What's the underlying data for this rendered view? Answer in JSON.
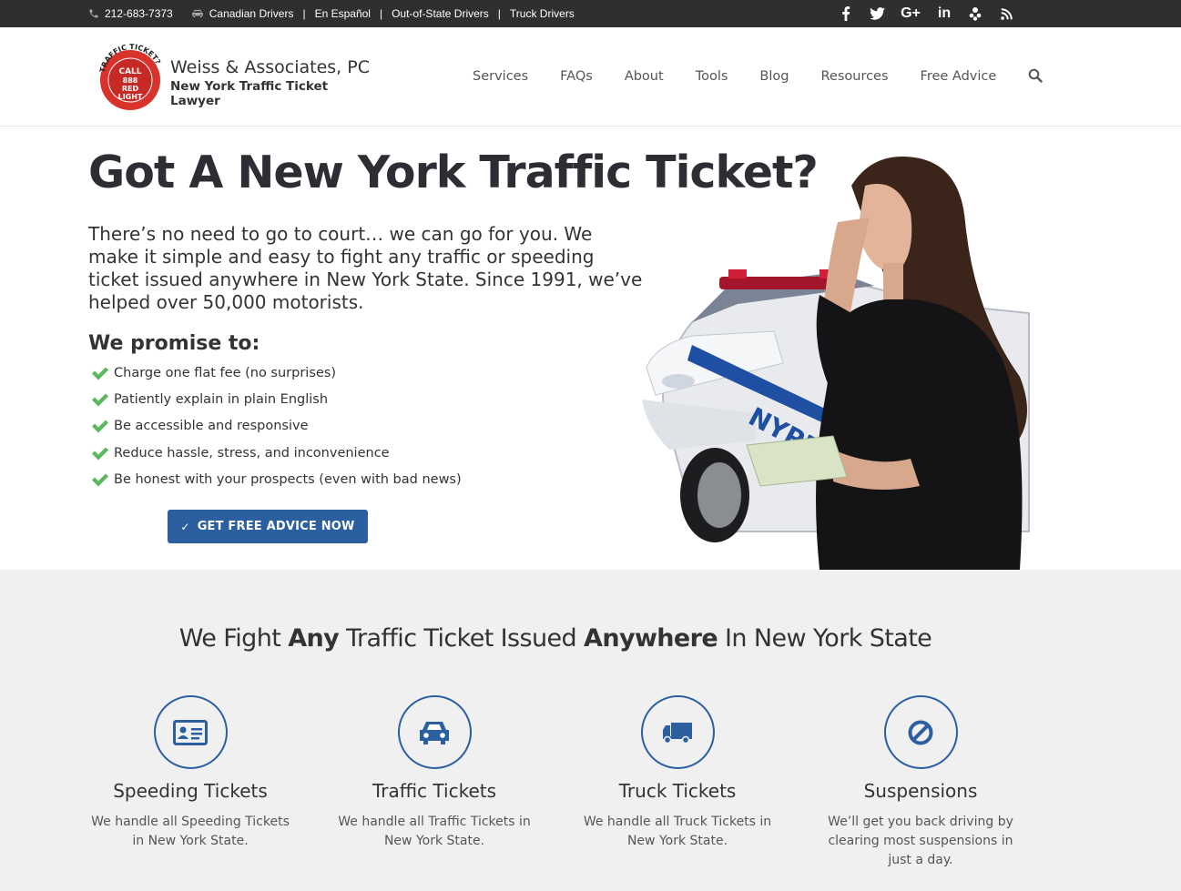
{
  "topbar": {
    "phone": "212-683-7373",
    "links": [
      "Canadian Drivers",
      "En Español",
      "Out-of-State Drivers",
      "Truck Drivers"
    ],
    "social_icons": [
      "facebook-icon",
      "twitter-icon",
      "google-plus-icon",
      "linkedin-icon",
      "yelp-icon",
      "rss-icon"
    ]
  },
  "header": {
    "logo_badge_lines": [
      "TRAFFIC TICKET?",
      "CALL",
      "888",
      "RED",
      "LIGHT"
    ],
    "firm_name": "Weiss & Associates, PC",
    "tagline": "New York Traffic Ticket Lawyer",
    "nav": [
      "Services",
      "FAQs",
      "About",
      "Tools",
      "Blog",
      "Resources",
      "Free Advice"
    ]
  },
  "hero": {
    "title": "Got A New York Traffic Ticket?",
    "lead": "There’s no need to go to court… we can go for you. We make it simple and easy to fight any traffic or speeding ticket issued anywhere in New York State. Since 1991, we’ve helped over 50,000 motorists.",
    "promise_title": "We promise to:",
    "promises": [
      "Charge one flat fee (no surprises)",
      "Patiently explain in plain English",
      "Be accessible and responsive",
      "Reduce hassle, stress, and inconvenience",
      "Be honest with your prospects (even with bad news)"
    ],
    "cta_label": "GET FREE ADVICE NOW",
    "car_text": "NYPD"
  },
  "services": {
    "heading_parts": [
      "We Fight ",
      "Any",
      " Traffic Ticket Issued ",
      "Anywhere",
      " In New York State"
    ],
    "items": [
      {
        "icon": "id-card-icon",
        "title": "Speeding Tickets",
        "desc": "We handle all Speeding Tickets in New York State."
      },
      {
        "icon": "car-icon",
        "title": "Traffic Tickets",
        "desc": "We handle all Traffic Tickets in New York State."
      },
      {
        "icon": "truck-icon",
        "title": "Truck Tickets",
        "desc": "We handle all Truck Tickets in New York State."
      },
      {
        "icon": "ban-icon",
        "title": "Suspensions",
        "desc": "We’ll get you back driving by clearing most suspensions in just a day."
      }
    ]
  },
  "colors": {
    "topbar_bg": "#2f2f31",
    "accent_blue": "#2b5fa0",
    "check_green": "#5cb85c",
    "logo_red": "#d9322b",
    "services_bg": "#f0f0f0"
  }
}
